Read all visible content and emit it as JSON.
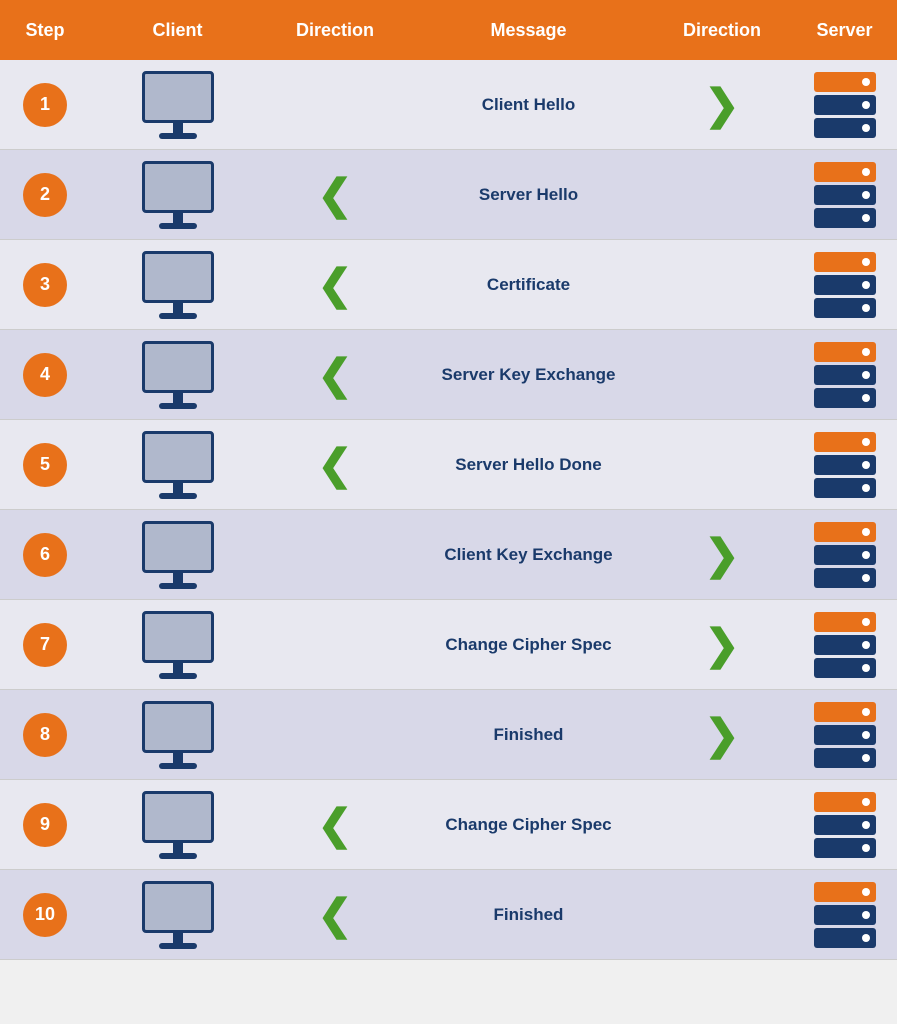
{
  "header": {
    "step": "Step",
    "client": "Client",
    "direction_left": "Direction",
    "message": "Message",
    "direction_right": "Direction",
    "server": "Server"
  },
  "rows": [
    {
      "step": "1",
      "direction": "right",
      "message": "Client Hello"
    },
    {
      "step": "2",
      "direction": "left",
      "message": "Server Hello"
    },
    {
      "step": "3",
      "direction": "left",
      "message": "Certificate"
    },
    {
      "step": "4",
      "direction": "left",
      "message": "Server Key Exchange"
    },
    {
      "step": "5",
      "direction": "left",
      "message": "Server Hello Done"
    },
    {
      "step": "6",
      "direction": "right",
      "message": "Client Key Exchange"
    },
    {
      "step": "7",
      "direction": "right",
      "message": "Change Cipher Spec"
    },
    {
      "step": "8",
      "direction": "right",
      "message": "Finished"
    },
    {
      "step": "9",
      "direction": "left",
      "message": "Change Cipher Spec"
    },
    {
      "step": "10",
      "direction": "left",
      "message": "Finished"
    }
  ]
}
